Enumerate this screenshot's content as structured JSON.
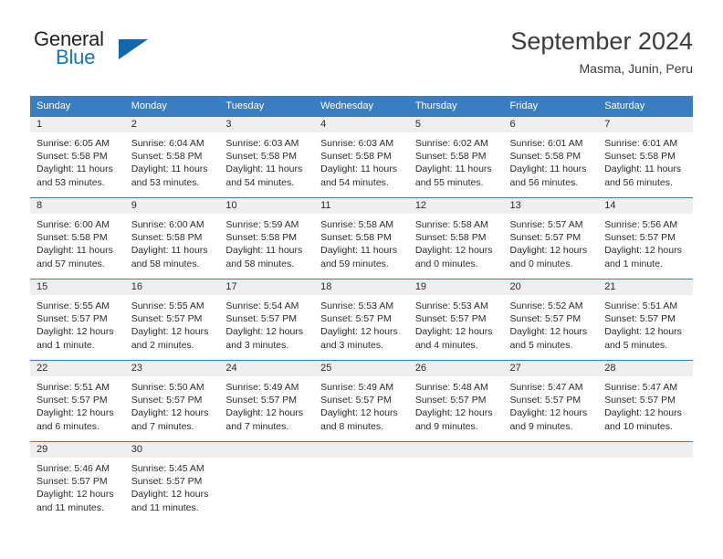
{
  "brand": {
    "name_part1": "General",
    "name_part2": "Blue",
    "logo_icon": "triangle-logo-icon"
  },
  "header": {
    "title": "September 2024",
    "subtitle": "Masma, Junin, Peru"
  },
  "colors": {
    "header_blue": "#3a7dc0",
    "brand_blue": "#1278be",
    "daynum_background": "#efefef",
    "text": "#2b2b2b"
  },
  "calendar": {
    "weekday_headers": [
      "Sunday",
      "Monday",
      "Tuesday",
      "Wednesday",
      "Thursday",
      "Friday",
      "Saturday"
    ],
    "weeks": [
      [
        {
          "day": "1",
          "sunrise": "Sunrise: 6:05 AM",
          "sunset": "Sunset: 5:58 PM",
          "daylight": "Daylight: 11 hours and 53 minutes."
        },
        {
          "day": "2",
          "sunrise": "Sunrise: 6:04 AM",
          "sunset": "Sunset: 5:58 PM",
          "daylight": "Daylight: 11 hours and 53 minutes."
        },
        {
          "day": "3",
          "sunrise": "Sunrise: 6:03 AM",
          "sunset": "Sunset: 5:58 PM",
          "daylight": "Daylight: 11 hours and 54 minutes."
        },
        {
          "day": "4",
          "sunrise": "Sunrise: 6:03 AM",
          "sunset": "Sunset: 5:58 PM",
          "daylight": "Daylight: 11 hours and 54 minutes."
        },
        {
          "day": "5",
          "sunrise": "Sunrise: 6:02 AM",
          "sunset": "Sunset: 5:58 PM",
          "daylight": "Daylight: 11 hours and 55 minutes."
        },
        {
          "day": "6",
          "sunrise": "Sunrise: 6:01 AM",
          "sunset": "Sunset: 5:58 PM",
          "daylight": "Daylight: 11 hours and 56 minutes."
        },
        {
          "day": "7",
          "sunrise": "Sunrise: 6:01 AM",
          "sunset": "Sunset: 5:58 PM",
          "daylight": "Daylight: 11 hours and 56 minutes."
        }
      ],
      [
        {
          "day": "8",
          "sunrise": "Sunrise: 6:00 AM",
          "sunset": "Sunset: 5:58 PM",
          "daylight": "Daylight: 11 hours and 57 minutes."
        },
        {
          "day": "9",
          "sunrise": "Sunrise: 6:00 AM",
          "sunset": "Sunset: 5:58 PM",
          "daylight": "Daylight: 11 hours and 58 minutes."
        },
        {
          "day": "10",
          "sunrise": "Sunrise: 5:59 AM",
          "sunset": "Sunset: 5:58 PM",
          "daylight": "Daylight: 11 hours and 58 minutes."
        },
        {
          "day": "11",
          "sunrise": "Sunrise: 5:58 AM",
          "sunset": "Sunset: 5:58 PM",
          "daylight": "Daylight: 11 hours and 59 minutes."
        },
        {
          "day": "12",
          "sunrise": "Sunrise: 5:58 AM",
          "sunset": "Sunset: 5:58 PM",
          "daylight": "Daylight: 12 hours and 0 minutes."
        },
        {
          "day": "13",
          "sunrise": "Sunrise: 5:57 AM",
          "sunset": "Sunset: 5:57 PM",
          "daylight": "Daylight: 12 hours and 0 minutes."
        },
        {
          "day": "14",
          "sunrise": "Sunrise: 5:56 AM",
          "sunset": "Sunset: 5:57 PM",
          "daylight": "Daylight: 12 hours and 1 minute."
        }
      ],
      [
        {
          "day": "15",
          "sunrise": "Sunrise: 5:55 AM",
          "sunset": "Sunset: 5:57 PM",
          "daylight": "Daylight: 12 hours and 1 minute."
        },
        {
          "day": "16",
          "sunrise": "Sunrise: 5:55 AM",
          "sunset": "Sunset: 5:57 PM",
          "daylight": "Daylight: 12 hours and 2 minutes."
        },
        {
          "day": "17",
          "sunrise": "Sunrise: 5:54 AM",
          "sunset": "Sunset: 5:57 PM",
          "daylight": "Daylight: 12 hours and 3 minutes."
        },
        {
          "day": "18",
          "sunrise": "Sunrise: 5:53 AM",
          "sunset": "Sunset: 5:57 PM",
          "daylight": "Daylight: 12 hours and 3 minutes."
        },
        {
          "day": "19",
          "sunrise": "Sunrise: 5:53 AM",
          "sunset": "Sunset: 5:57 PM",
          "daylight": "Daylight: 12 hours and 4 minutes."
        },
        {
          "day": "20",
          "sunrise": "Sunrise: 5:52 AM",
          "sunset": "Sunset: 5:57 PM",
          "daylight": "Daylight: 12 hours and 5 minutes."
        },
        {
          "day": "21",
          "sunrise": "Sunrise: 5:51 AM",
          "sunset": "Sunset: 5:57 PM",
          "daylight": "Daylight: 12 hours and 5 minutes."
        }
      ],
      [
        {
          "day": "22",
          "sunrise": "Sunrise: 5:51 AM",
          "sunset": "Sunset: 5:57 PM",
          "daylight": "Daylight: 12 hours and 6 minutes."
        },
        {
          "day": "23",
          "sunrise": "Sunrise: 5:50 AM",
          "sunset": "Sunset: 5:57 PM",
          "daylight": "Daylight: 12 hours and 7 minutes."
        },
        {
          "day": "24",
          "sunrise": "Sunrise: 5:49 AM",
          "sunset": "Sunset: 5:57 PM",
          "daylight": "Daylight: 12 hours and 7 minutes."
        },
        {
          "day": "25",
          "sunrise": "Sunrise: 5:49 AM",
          "sunset": "Sunset: 5:57 PM",
          "daylight": "Daylight: 12 hours and 8 minutes."
        },
        {
          "day": "26",
          "sunrise": "Sunrise: 5:48 AM",
          "sunset": "Sunset: 5:57 PM",
          "daylight": "Daylight: 12 hours and 9 minutes."
        },
        {
          "day": "27",
          "sunrise": "Sunrise: 5:47 AM",
          "sunset": "Sunset: 5:57 PM",
          "daylight": "Daylight: 12 hours and 9 minutes."
        },
        {
          "day": "28",
          "sunrise": "Sunrise: 5:47 AM",
          "sunset": "Sunset: 5:57 PM",
          "daylight": "Daylight: 12 hours and 10 minutes."
        }
      ],
      [
        {
          "day": "29",
          "sunrise": "Sunrise: 5:46 AM",
          "sunset": "Sunset: 5:57 PM",
          "daylight": "Daylight: 12 hours and 11 minutes."
        },
        {
          "day": "30",
          "sunrise": "Sunrise: 5:45 AM",
          "sunset": "Sunset: 5:57 PM",
          "daylight": "Daylight: 12 hours and 11 minutes."
        },
        {
          "day": "",
          "sunrise": "",
          "sunset": "",
          "daylight": ""
        },
        {
          "day": "",
          "sunrise": "",
          "sunset": "",
          "daylight": ""
        },
        {
          "day": "",
          "sunrise": "",
          "sunset": "",
          "daylight": ""
        },
        {
          "day": "",
          "sunrise": "",
          "sunset": "",
          "daylight": ""
        },
        {
          "day": "",
          "sunrise": "",
          "sunset": "",
          "daylight": ""
        }
      ]
    ]
  }
}
